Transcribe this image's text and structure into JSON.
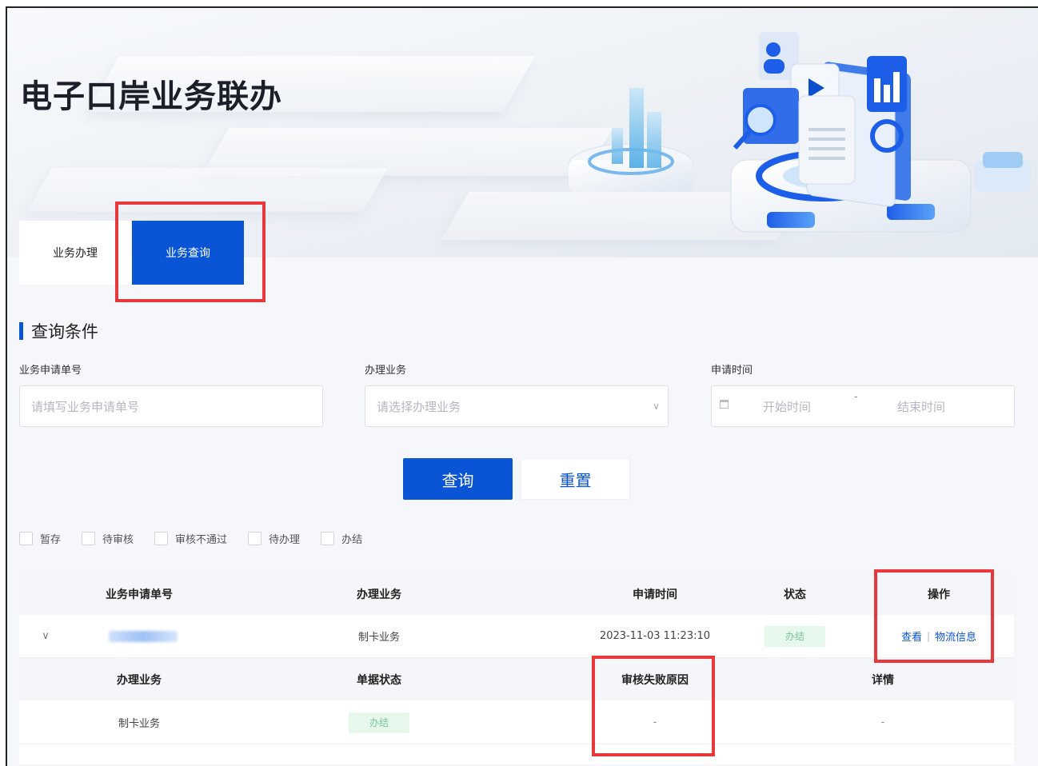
{
  "banner": {
    "title": "电子口岸业务联办"
  },
  "tabs": [
    {
      "label": "业务办理",
      "active": false
    },
    {
      "label": "业务查询",
      "active": true
    }
  ],
  "section": {
    "title": "查询条件"
  },
  "form": {
    "application_no": {
      "label": "业务申请单号",
      "placeholder": "请填写业务申请单号"
    },
    "business": {
      "label": "办理业务",
      "placeholder": "请选择办理业务"
    },
    "apply_time": {
      "label": "申请时间",
      "start_placeholder": "开始时间",
      "separator": "-",
      "end_placeholder": "结束时间"
    }
  },
  "buttons": {
    "query": "查询",
    "reset": "重置"
  },
  "status_filters": [
    "暂存",
    "待审核",
    "审核不通过",
    "待办理",
    "办结"
  ],
  "table": {
    "headers": {
      "application_no": "业务申请单号",
      "business": "办理业务",
      "apply_time": "申请时间",
      "status": "状态",
      "action": "操作"
    },
    "row": {
      "business": "制卡业务",
      "apply_time": "2023-11-03 11:23:10",
      "status": "办结",
      "action_view": "查看",
      "action_logistics": "物流信息"
    },
    "sub_headers": {
      "business": "办理业务",
      "doc_status": "单据状态",
      "fail_reason": "审核失败原因",
      "detail": "详情"
    },
    "sub_row": {
      "business": "制卡业务",
      "doc_status": "办结",
      "fail_reason": "-",
      "detail": "-"
    }
  },
  "colors": {
    "primary": "#0a54d6",
    "highlight_box": "#e8383b",
    "success_bg": "#e6f7ec"
  }
}
